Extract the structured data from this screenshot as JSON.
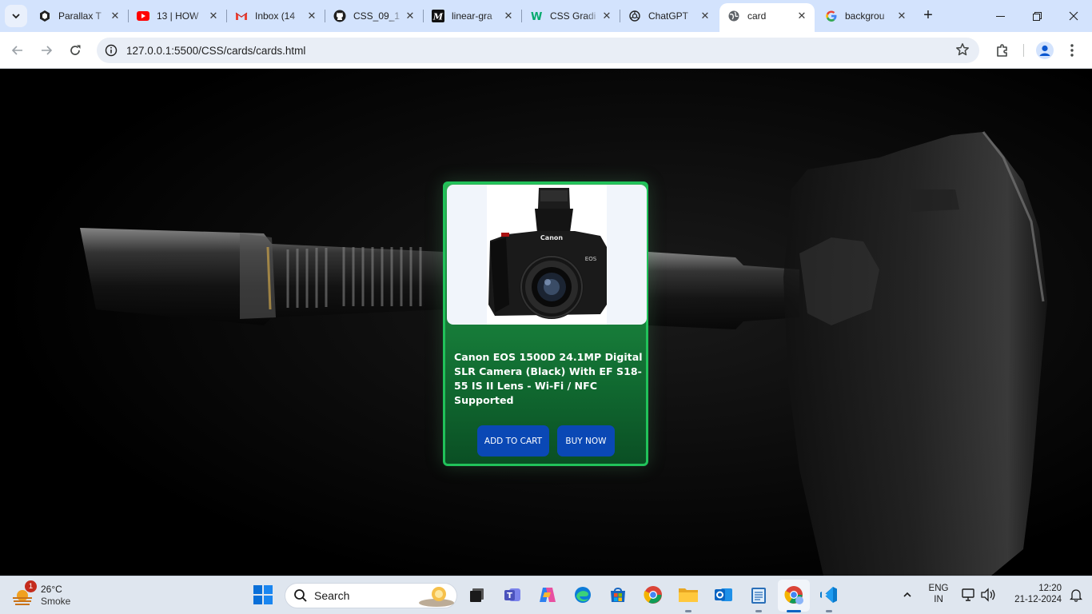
{
  "browser": {
    "tabs": [
      {
        "title": "Parallax T",
        "icon": "parallax-icon"
      },
      {
        "title": "13 | HOW",
        "icon": "youtube-icon"
      },
      {
        "title": "Inbox (14",
        "icon": "gmail-icon"
      },
      {
        "title": "CSS_09_1",
        "icon": "github-icon"
      },
      {
        "title": "linear-gra",
        "icon": "medium-icon"
      },
      {
        "title": "CSS Gradi",
        "icon": "w3schools-icon"
      },
      {
        "title": "ChatGPT",
        "icon": "chatgpt-icon"
      },
      {
        "title": "card",
        "icon": "globe-icon",
        "active": true
      },
      {
        "title": "backgrou",
        "icon": "google-icon"
      }
    ],
    "address": {
      "url": "127.0.0.1:5500/CSS/cards/cards.html"
    }
  },
  "card": {
    "title": "Canon EOS 1500D 24.1MP Digital SLR Camera (Black) With EF S18-55 IS II Lens - Wi-Fi / NFC Supported",
    "add_to_cart": "ADD TO CART",
    "buy_now": "BUY NOW",
    "image": {
      "brand": "Canon",
      "model": "EOS"
    },
    "accent": "#21c25a",
    "button_color": "#0a48b5"
  },
  "taskbar": {
    "weather": {
      "temp": "26°C",
      "condition": "Smoke",
      "badge": "1"
    },
    "search_label": "Search",
    "tray": {
      "lang": "ENG",
      "region": "IN",
      "time": "12:20",
      "date": "21-12-2024"
    }
  }
}
